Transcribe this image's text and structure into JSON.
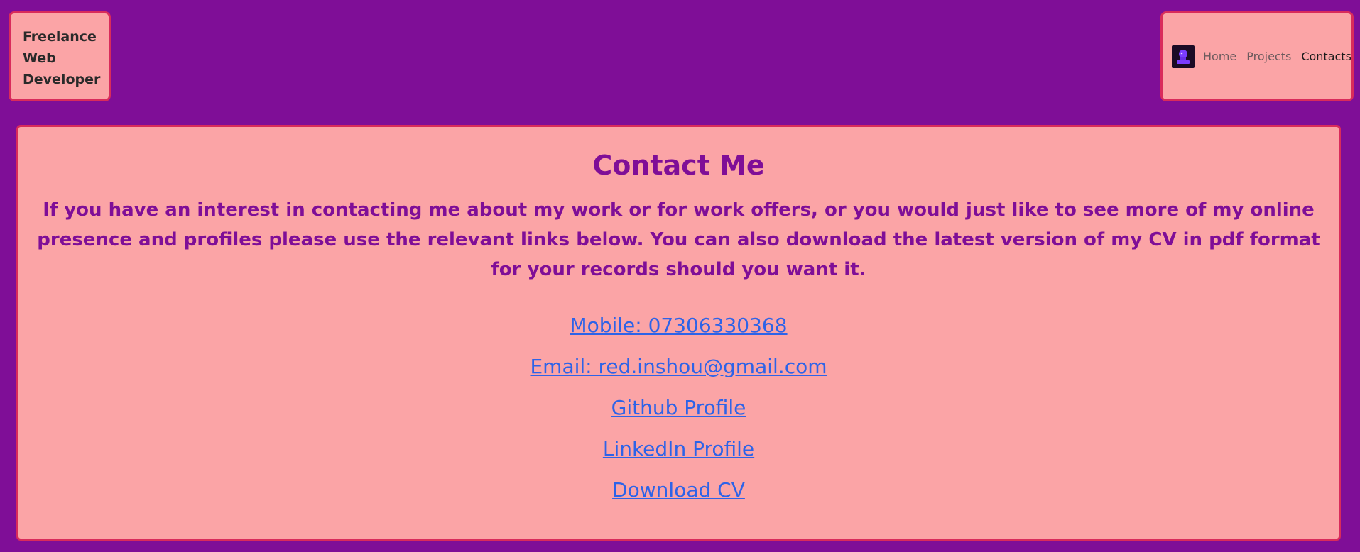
{
  "brand": {
    "title": "Freelance Web Developer"
  },
  "nav": {
    "logo_icon": "user-avatar-icon",
    "items": [
      {
        "label": "Home",
        "active": false
      },
      {
        "label": "Projects",
        "active": false
      },
      {
        "label": "Contacts",
        "active": true
      }
    ]
  },
  "contact": {
    "title": "Contact Me",
    "intro": "If you have an interest in contacting me about my work or for work offers, or you would just like to see more of my online presence and profiles please use the relevant links below. You can also download the latest version of my CV in pdf format for your records should you want it.",
    "links": [
      {
        "label": "Mobile: 07306330368"
      },
      {
        "label": "Email: red.inshou@gmail.com"
      },
      {
        "label": "Github Profile"
      },
      {
        "label": "LinkedIn Profile"
      },
      {
        "label": "Download CV"
      }
    ]
  },
  "colors": {
    "background": "#7f0e97",
    "panel": "#fba4a6",
    "border": "#d92b5b",
    "heading": "#7f0e97",
    "link": "#2d63e8"
  }
}
